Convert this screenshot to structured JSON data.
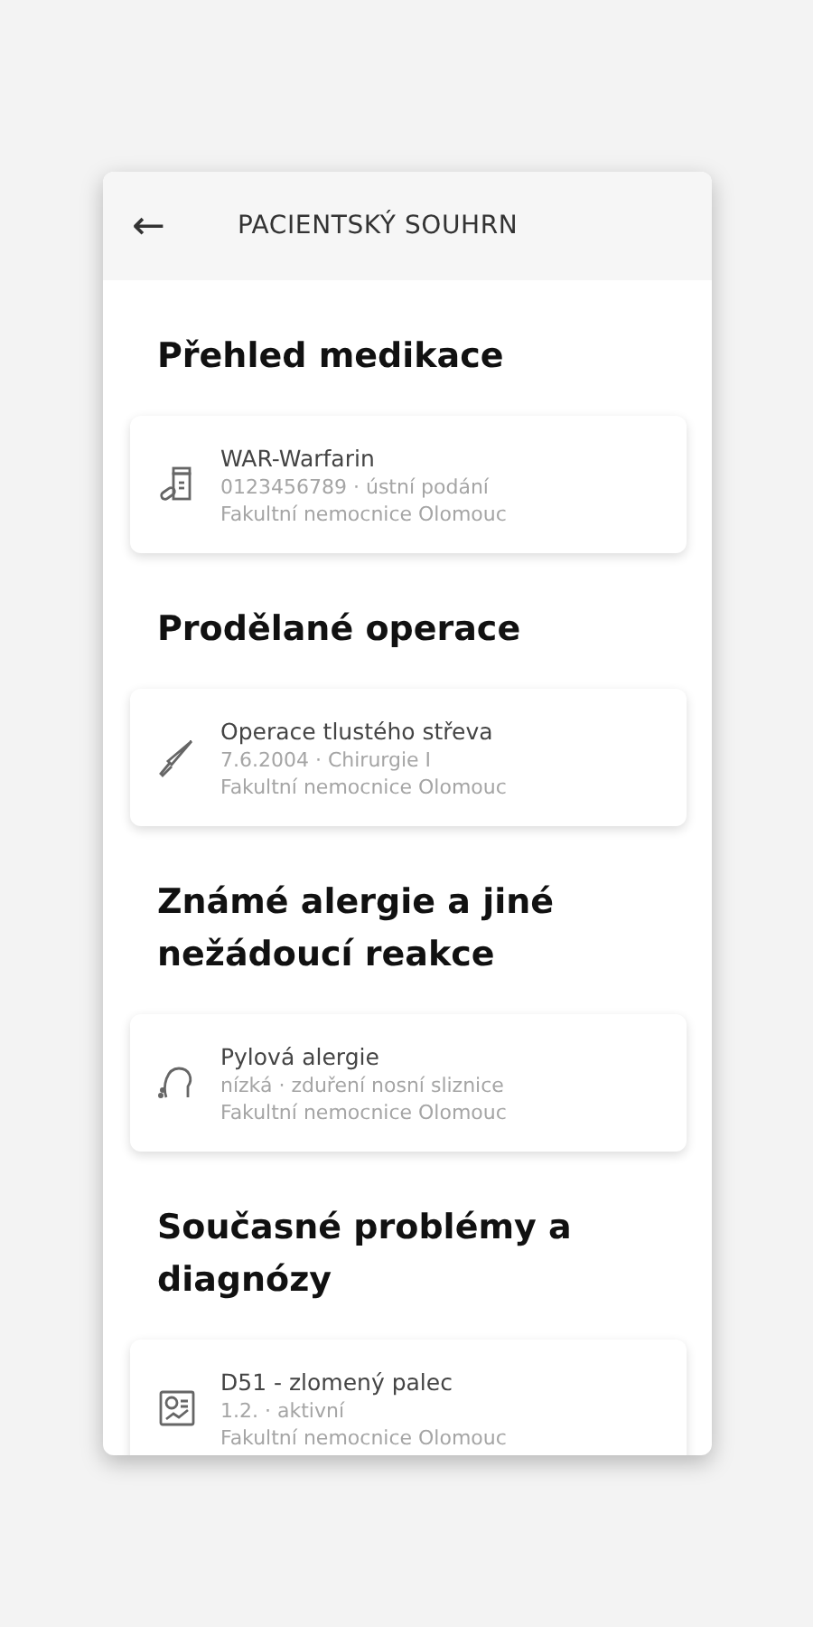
{
  "header": {
    "back": "←",
    "title": "PACIENTSKÝ SOUHRN"
  },
  "sections": [
    {
      "title": "Přehled medikace",
      "items": [
        {
          "kind": "medication",
          "name": "WAR-Warfarin",
          "detail": "0123456789 · ústní podání",
          "facility": "Fakultní nemocnice Olomouc"
        }
      ]
    },
    {
      "title": "Prodělané operace",
      "items": [
        {
          "kind": "surgery",
          "name": "Operace tlustého střeva",
          "detail": "7.6.2004 · Chirurgie I",
          "facility": "Fakultní nemocnice Olomouc"
        }
      ]
    },
    {
      "title": "Známé alergie a jiné nežádoucí reakce",
      "items": [
        {
          "kind": "allergy",
          "name": "Pylová alergie",
          "detail": "nízká · zduření nosní sliznice",
          "facility": "Fakultní nemocnice Olomouc"
        }
      ]
    },
    {
      "title": "Současné problémy a diagnózy",
      "items": [
        {
          "kind": "diagnosis",
          "name": "D51 - zlomený palec",
          "detail": "1.2. · aktivní",
          "facility": "Fakultní nemocnice Olomouc"
        }
      ]
    }
  ]
}
